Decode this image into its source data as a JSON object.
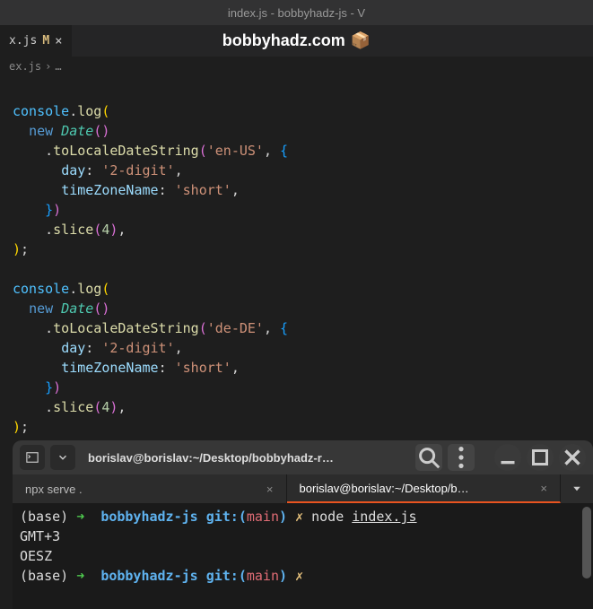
{
  "window": {
    "title": "index.js - bobbyhadz-js - V"
  },
  "tab": {
    "filename": "x.js",
    "modified": "M",
    "close": "×"
  },
  "watermark": {
    "text": "bobbyhadz.com",
    "icon": "📦"
  },
  "breadcrumb": {
    "file": "ex.js",
    "sep": "›",
    "more": "…"
  },
  "code": {
    "console": "console",
    "dot": ".",
    "log": "log",
    "new": "new",
    "Date": "Date",
    "toLocaleDateString": "toLocaleDateString",
    "locale_us": "'en-US'",
    "locale_de": "'de-DE'",
    "day": "day",
    "digit2": "'2-digit'",
    "timeZoneName": "timeZoneName",
    "short": "'short'",
    "slice": "slice",
    "four": "4",
    "comma": ",",
    "colon": ":",
    "semi": ";",
    "lp_y": "(",
    "rp_y": ")",
    "lp_p": "(",
    "rp_p": ")",
    "lp_b": "(",
    "rp_b": ")",
    "lb_p": "{",
    "rb_p": "}"
  },
  "terminal": {
    "title": "borislav@borislav:~/Desktop/bobbyhadz-r…",
    "tabs": [
      {
        "label": "npx serve .",
        "active": false
      },
      {
        "label": "borislav@borislav:~/Desktop/b…",
        "active": true
      }
    ],
    "lines": {
      "base": "(base)",
      "arrow": "➜",
      "dir": "bobbyhadz-js",
      "git": "git:(",
      "branch": "main",
      "gitclose": ")",
      "x": "✗",
      "cmd": "node",
      "file": "index.js",
      "out1": "GMT+3",
      "out2": "OESZ"
    }
  }
}
